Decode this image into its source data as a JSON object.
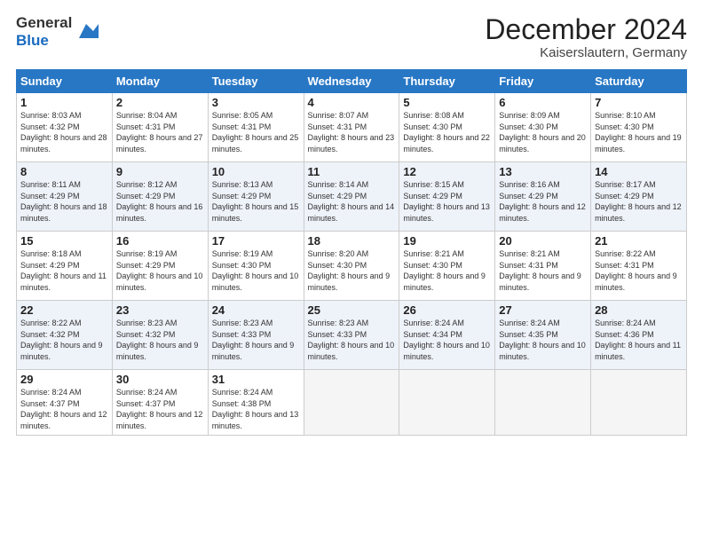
{
  "logo": {
    "general": "General",
    "blue": "Blue"
  },
  "header": {
    "month": "December 2024",
    "location": "Kaiserslautern, Germany"
  },
  "weekdays": [
    "Sunday",
    "Monday",
    "Tuesday",
    "Wednesday",
    "Thursday",
    "Friday",
    "Saturday"
  ],
  "weeks": [
    [
      {
        "day": "1",
        "sunrise": "Sunrise: 8:03 AM",
        "sunset": "Sunset: 4:32 PM",
        "daylight": "Daylight: 8 hours and 28 minutes."
      },
      {
        "day": "2",
        "sunrise": "Sunrise: 8:04 AM",
        "sunset": "Sunset: 4:31 PM",
        "daylight": "Daylight: 8 hours and 27 minutes."
      },
      {
        "day": "3",
        "sunrise": "Sunrise: 8:05 AM",
        "sunset": "Sunset: 4:31 PM",
        "daylight": "Daylight: 8 hours and 25 minutes."
      },
      {
        "day": "4",
        "sunrise": "Sunrise: 8:07 AM",
        "sunset": "Sunset: 4:31 PM",
        "daylight": "Daylight: 8 hours and 23 minutes."
      },
      {
        "day": "5",
        "sunrise": "Sunrise: 8:08 AM",
        "sunset": "Sunset: 4:30 PM",
        "daylight": "Daylight: 8 hours and 22 minutes."
      },
      {
        "day": "6",
        "sunrise": "Sunrise: 8:09 AM",
        "sunset": "Sunset: 4:30 PM",
        "daylight": "Daylight: 8 hours and 20 minutes."
      },
      {
        "day": "7",
        "sunrise": "Sunrise: 8:10 AM",
        "sunset": "Sunset: 4:30 PM",
        "daylight": "Daylight: 8 hours and 19 minutes."
      }
    ],
    [
      {
        "day": "8",
        "sunrise": "Sunrise: 8:11 AM",
        "sunset": "Sunset: 4:29 PM",
        "daylight": "Daylight: 8 hours and 18 minutes."
      },
      {
        "day": "9",
        "sunrise": "Sunrise: 8:12 AM",
        "sunset": "Sunset: 4:29 PM",
        "daylight": "Daylight: 8 hours and 16 minutes."
      },
      {
        "day": "10",
        "sunrise": "Sunrise: 8:13 AM",
        "sunset": "Sunset: 4:29 PM",
        "daylight": "Daylight: 8 hours and 15 minutes."
      },
      {
        "day": "11",
        "sunrise": "Sunrise: 8:14 AM",
        "sunset": "Sunset: 4:29 PM",
        "daylight": "Daylight: 8 hours and 14 minutes."
      },
      {
        "day": "12",
        "sunrise": "Sunrise: 8:15 AM",
        "sunset": "Sunset: 4:29 PM",
        "daylight": "Daylight: 8 hours and 13 minutes."
      },
      {
        "day": "13",
        "sunrise": "Sunrise: 8:16 AM",
        "sunset": "Sunset: 4:29 PM",
        "daylight": "Daylight: 8 hours and 12 minutes."
      },
      {
        "day": "14",
        "sunrise": "Sunrise: 8:17 AM",
        "sunset": "Sunset: 4:29 PM",
        "daylight": "Daylight: 8 hours and 12 minutes."
      }
    ],
    [
      {
        "day": "15",
        "sunrise": "Sunrise: 8:18 AM",
        "sunset": "Sunset: 4:29 PM",
        "daylight": "Daylight: 8 hours and 11 minutes."
      },
      {
        "day": "16",
        "sunrise": "Sunrise: 8:19 AM",
        "sunset": "Sunset: 4:29 PM",
        "daylight": "Daylight: 8 hours and 10 minutes."
      },
      {
        "day": "17",
        "sunrise": "Sunrise: 8:19 AM",
        "sunset": "Sunset: 4:30 PM",
        "daylight": "Daylight: 8 hours and 10 minutes."
      },
      {
        "day": "18",
        "sunrise": "Sunrise: 8:20 AM",
        "sunset": "Sunset: 4:30 PM",
        "daylight": "Daylight: 8 hours and 9 minutes."
      },
      {
        "day": "19",
        "sunrise": "Sunrise: 8:21 AM",
        "sunset": "Sunset: 4:30 PM",
        "daylight": "Daylight: 8 hours and 9 minutes."
      },
      {
        "day": "20",
        "sunrise": "Sunrise: 8:21 AM",
        "sunset": "Sunset: 4:31 PM",
        "daylight": "Daylight: 8 hours and 9 minutes."
      },
      {
        "day": "21",
        "sunrise": "Sunrise: 8:22 AM",
        "sunset": "Sunset: 4:31 PM",
        "daylight": "Daylight: 8 hours and 9 minutes."
      }
    ],
    [
      {
        "day": "22",
        "sunrise": "Sunrise: 8:22 AM",
        "sunset": "Sunset: 4:32 PM",
        "daylight": "Daylight: 8 hours and 9 minutes."
      },
      {
        "day": "23",
        "sunrise": "Sunrise: 8:23 AM",
        "sunset": "Sunset: 4:32 PM",
        "daylight": "Daylight: 8 hours and 9 minutes."
      },
      {
        "day": "24",
        "sunrise": "Sunrise: 8:23 AM",
        "sunset": "Sunset: 4:33 PM",
        "daylight": "Daylight: 8 hours and 9 minutes."
      },
      {
        "day": "25",
        "sunrise": "Sunrise: 8:23 AM",
        "sunset": "Sunset: 4:33 PM",
        "daylight": "Daylight: 8 hours and 10 minutes."
      },
      {
        "day": "26",
        "sunrise": "Sunrise: 8:24 AM",
        "sunset": "Sunset: 4:34 PM",
        "daylight": "Daylight: 8 hours and 10 minutes."
      },
      {
        "day": "27",
        "sunrise": "Sunrise: 8:24 AM",
        "sunset": "Sunset: 4:35 PM",
        "daylight": "Daylight: 8 hours and 10 minutes."
      },
      {
        "day": "28",
        "sunrise": "Sunrise: 8:24 AM",
        "sunset": "Sunset: 4:36 PM",
        "daylight": "Daylight: 8 hours and 11 minutes."
      }
    ],
    [
      {
        "day": "29",
        "sunrise": "Sunrise: 8:24 AM",
        "sunset": "Sunset: 4:37 PM",
        "daylight": "Daylight: 8 hours and 12 minutes."
      },
      {
        "day": "30",
        "sunrise": "Sunrise: 8:24 AM",
        "sunset": "Sunset: 4:37 PM",
        "daylight": "Daylight: 8 hours and 12 minutes."
      },
      {
        "day": "31",
        "sunrise": "Sunrise: 8:24 AM",
        "sunset": "Sunset: 4:38 PM",
        "daylight": "Daylight: 8 hours and 13 minutes."
      },
      null,
      null,
      null,
      null
    ]
  ]
}
